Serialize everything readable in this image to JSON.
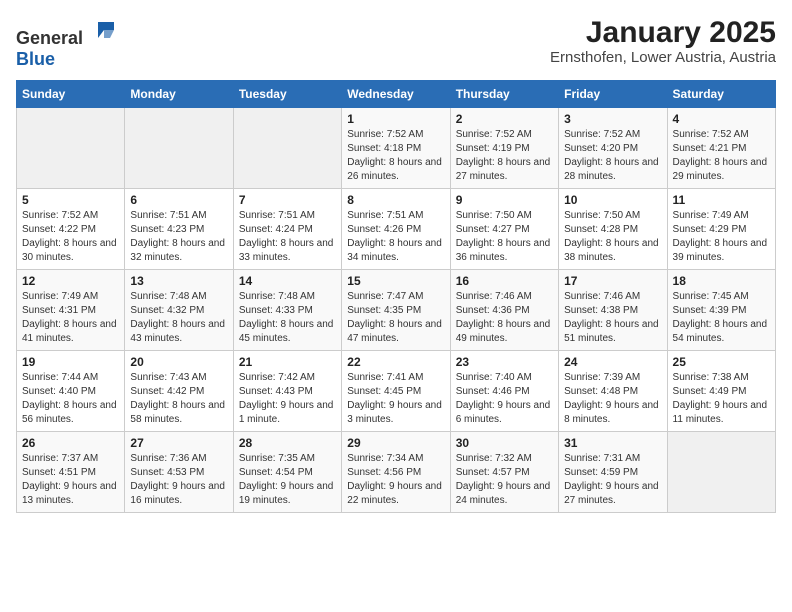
{
  "logo": {
    "general": "General",
    "blue": "Blue"
  },
  "title": "January 2025",
  "subtitle": "Ernsthofen, Lower Austria, Austria",
  "days_of_week": [
    "Sunday",
    "Monday",
    "Tuesday",
    "Wednesday",
    "Thursday",
    "Friday",
    "Saturday"
  ],
  "weeks": [
    [
      {
        "day": "",
        "sunrise": "",
        "sunset": "",
        "daylight": "",
        "empty": true
      },
      {
        "day": "",
        "sunrise": "",
        "sunset": "",
        "daylight": "",
        "empty": true
      },
      {
        "day": "",
        "sunrise": "",
        "sunset": "",
        "daylight": "",
        "empty": true
      },
      {
        "day": "1",
        "sunrise": "Sunrise: 7:52 AM",
        "sunset": "Sunset: 4:18 PM",
        "daylight": "Daylight: 8 hours and 26 minutes."
      },
      {
        "day": "2",
        "sunrise": "Sunrise: 7:52 AM",
        "sunset": "Sunset: 4:19 PM",
        "daylight": "Daylight: 8 hours and 27 minutes."
      },
      {
        "day": "3",
        "sunrise": "Sunrise: 7:52 AM",
        "sunset": "Sunset: 4:20 PM",
        "daylight": "Daylight: 8 hours and 28 minutes."
      },
      {
        "day": "4",
        "sunrise": "Sunrise: 7:52 AM",
        "sunset": "Sunset: 4:21 PM",
        "daylight": "Daylight: 8 hours and 29 minutes."
      }
    ],
    [
      {
        "day": "5",
        "sunrise": "Sunrise: 7:52 AM",
        "sunset": "Sunset: 4:22 PM",
        "daylight": "Daylight: 8 hours and 30 minutes."
      },
      {
        "day": "6",
        "sunrise": "Sunrise: 7:51 AM",
        "sunset": "Sunset: 4:23 PM",
        "daylight": "Daylight: 8 hours and 32 minutes."
      },
      {
        "day": "7",
        "sunrise": "Sunrise: 7:51 AM",
        "sunset": "Sunset: 4:24 PM",
        "daylight": "Daylight: 8 hours and 33 minutes."
      },
      {
        "day": "8",
        "sunrise": "Sunrise: 7:51 AM",
        "sunset": "Sunset: 4:26 PM",
        "daylight": "Daylight: 8 hours and 34 minutes."
      },
      {
        "day": "9",
        "sunrise": "Sunrise: 7:50 AM",
        "sunset": "Sunset: 4:27 PM",
        "daylight": "Daylight: 8 hours and 36 minutes."
      },
      {
        "day": "10",
        "sunrise": "Sunrise: 7:50 AM",
        "sunset": "Sunset: 4:28 PM",
        "daylight": "Daylight: 8 hours and 38 minutes."
      },
      {
        "day": "11",
        "sunrise": "Sunrise: 7:49 AM",
        "sunset": "Sunset: 4:29 PM",
        "daylight": "Daylight: 8 hours and 39 minutes."
      }
    ],
    [
      {
        "day": "12",
        "sunrise": "Sunrise: 7:49 AM",
        "sunset": "Sunset: 4:31 PM",
        "daylight": "Daylight: 8 hours and 41 minutes."
      },
      {
        "day": "13",
        "sunrise": "Sunrise: 7:48 AM",
        "sunset": "Sunset: 4:32 PM",
        "daylight": "Daylight: 8 hours and 43 minutes."
      },
      {
        "day": "14",
        "sunrise": "Sunrise: 7:48 AM",
        "sunset": "Sunset: 4:33 PM",
        "daylight": "Daylight: 8 hours and 45 minutes."
      },
      {
        "day": "15",
        "sunrise": "Sunrise: 7:47 AM",
        "sunset": "Sunset: 4:35 PM",
        "daylight": "Daylight: 8 hours and 47 minutes."
      },
      {
        "day": "16",
        "sunrise": "Sunrise: 7:46 AM",
        "sunset": "Sunset: 4:36 PM",
        "daylight": "Daylight: 8 hours and 49 minutes."
      },
      {
        "day": "17",
        "sunrise": "Sunrise: 7:46 AM",
        "sunset": "Sunset: 4:38 PM",
        "daylight": "Daylight: 8 hours and 51 minutes."
      },
      {
        "day": "18",
        "sunrise": "Sunrise: 7:45 AM",
        "sunset": "Sunset: 4:39 PM",
        "daylight": "Daylight: 8 hours and 54 minutes."
      }
    ],
    [
      {
        "day": "19",
        "sunrise": "Sunrise: 7:44 AM",
        "sunset": "Sunset: 4:40 PM",
        "daylight": "Daylight: 8 hours and 56 minutes."
      },
      {
        "day": "20",
        "sunrise": "Sunrise: 7:43 AM",
        "sunset": "Sunset: 4:42 PM",
        "daylight": "Daylight: 8 hours and 58 minutes."
      },
      {
        "day": "21",
        "sunrise": "Sunrise: 7:42 AM",
        "sunset": "Sunset: 4:43 PM",
        "daylight": "Daylight: 9 hours and 1 minute."
      },
      {
        "day": "22",
        "sunrise": "Sunrise: 7:41 AM",
        "sunset": "Sunset: 4:45 PM",
        "daylight": "Daylight: 9 hours and 3 minutes."
      },
      {
        "day": "23",
        "sunrise": "Sunrise: 7:40 AM",
        "sunset": "Sunset: 4:46 PM",
        "daylight": "Daylight: 9 hours and 6 minutes."
      },
      {
        "day": "24",
        "sunrise": "Sunrise: 7:39 AM",
        "sunset": "Sunset: 4:48 PM",
        "daylight": "Daylight: 9 hours and 8 minutes."
      },
      {
        "day": "25",
        "sunrise": "Sunrise: 7:38 AM",
        "sunset": "Sunset: 4:49 PM",
        "daylight": "Daylight: 9 hours and 11 minutes."
      }
    ],
    [
      {
        "day": "26",
        "sunrise": "Sunrise: 7:37 AM",
        "sunset": "Sunset: 4:51 PM",
        "daylight": "Daylight: 9 hours and 13 minutes."
      },
      {
        "day": "27",
        "sunrise": "Sunrise: 7:36 AM",
        "sunset": "Sunset: 4:53 PM",
        "daylight": "Daylight: 9 hours and 16 minutes."
      },
      {
        "day": "28",
        "sunrise": "Sunrise: 7:35 AM",
        "sunset": "Sunset: 4:54 PM",
        "daylight": "Daylight: 9 hours and 19 minutes."
      },
      {
        "day": "29",
        "sunrise": "Sunrise: 7:34 AM",
        "sunset": "Sunset: 4:56 PM",
        "daylight": "Daylight: 9 hours and 22 minutes."
      },
      {
        "day": "30",
        "sunrise": "Sunrise: 7:32 AM",
        "sunset": "Sunset: 4:57 PM",
        "daylight": "Daylight: 9 hours and 24 minutes."
      },
      {
        "day": "31",
        "sunrise": "Sunrise: 7:31 AM",
        "sunset": "Sunset: 4:59 PM",
        "daylight": "Daylight: 9 hours and 27 minutes."
      },
      {
        "day": "",
        "sunrise": "",
        "sunset": "",
        "daylight": "",
        "empty": true
      }
    ]
  ]
}
